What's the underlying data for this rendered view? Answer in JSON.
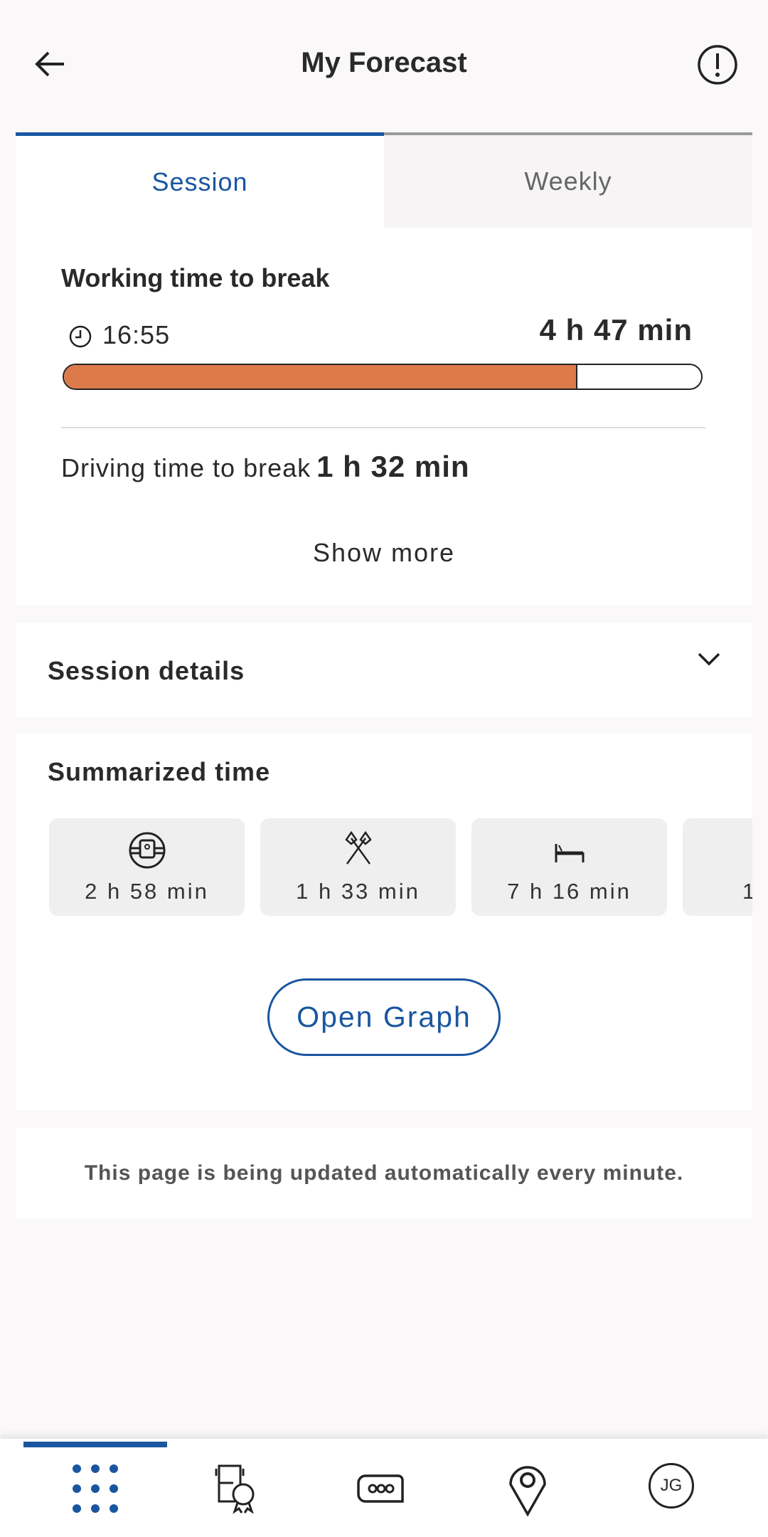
{
  "header": {
    "title": "My Forecast",
    "back_icon": "arrow-left-icon",
    "info_icon": "exclamation-circle-icon"
  },
  "tabs": [
    {
      "label": "Session",
      "active": true
    },
    {
      "label": "Weekly",
      "active": false
    }
  ],
  "working": {
    "title": "Working time to break",
    "clock_time": "16:55",
    "remaining": "4 h 47 min",
    "progress_percent": 80.6,
    "progress_color": "#dd7a4c"
  },
  "driving": {
    "label": "Driving time to break",
    "value": "1 h 32 min"
  },
  "show_more": "Show more",
  "session_details": {
    "title": "Session details"
  },
  "summarized": {
    "title": "Summarized time",
    "tiles": [
      {
        "icon": "steering-wheel-icon",
        "value": "2 h 58 min"
      },
      {
        "icon": "crossed-hammers-icon",
        "value": "1 h 33 min"
      },
      {
        "icon": "bed-icon",
        "value": "7 h 16 min"
      },
      {
        "icon": "unknown-icon",
        "value": "1"
      }
    ]
  },
  "open_graph": "Open Graph",
  "auto_update": "This page is being updated automatically every minute.",
  "nav": {
    "items": [
      {
        "icon": "grid-dots-icon",
        "active": true
      },
      {
        "icon": "truck-award-icon"
      },
      {
        "icon": "chat-bubble-icon"
      },
      {
        "icon": "location-pin-icon"
      },
      {
        "icon": "avatar-icon",
        "initials": "JG"
      }
    ]
  },
  "colors": {
    "accent": "#1a56a0"
  }
}
